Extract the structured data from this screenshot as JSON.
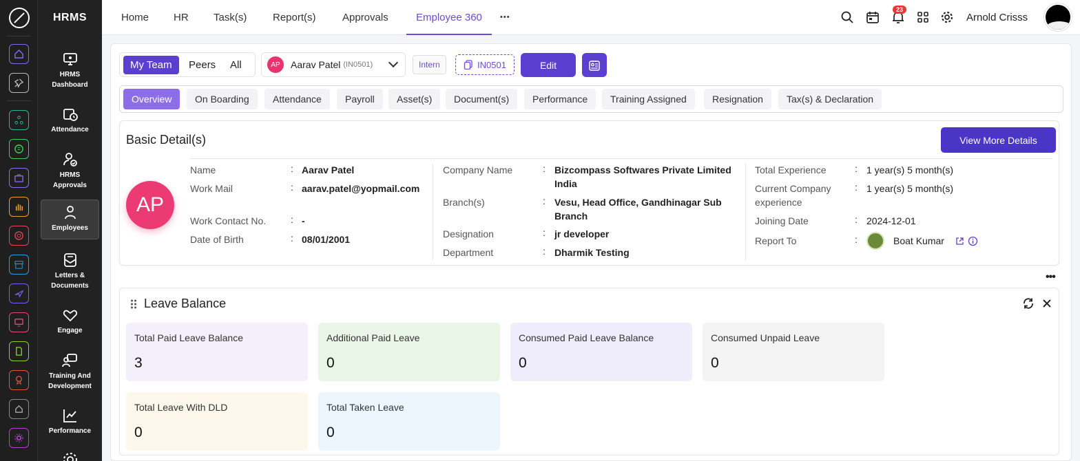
{
  "app": {
    "name": "HRMS"
  },
  "sidebar": {
    "items": [
      {
        "label_line1": "HRMS",
        "label_line2": "Dashboard"
      },
      {
        "label_line1": "Attendance",
        "label_line2": ""
      },
      {
        "label_line1": "HRMS",
        "label_line2": "Approvals"
      },
      {
        "label_line1": "Employees",
        "label_line2": ""
      },
      {
        "label_line1": "Letters &",
        "label_line2": "Documents"
      },
      {
        "label_line1": "Engage",
        "label_line2": ""
      },
      {
        "label_line1": "Training And",
        "label_line2": "Development"
      },
      {
        "label_line1": "Performance",
        "label_line2": ""
      }
    ]
  },
  "topnav": {
    "items": [
      "Home",
      "HR",
      "Task(s)",
      "Report(s)",
      "Approvals",
      "Employee 360"
    ],
    "more": "•••",
    "notifications_count": "23",
    "user_name": "Arnold Crisss"
  },
  "filter": {
    "segments": [
      "My Team",
      "Peers",
      "All"
    ],
    "employee_initials": "AP",
    "employee_name": "Aarav Patel",
    "employee_code": "(IN0501)",
    "type_tag": "Intern",
    "code_tag": "IN0501",
    "edit_label": "Edit"
  },
  "tabs": [
    "Overview",
    "On Boarding",
    "Attendance",
    "Payroll",
    "Asset(s)",
    "Document(s)",
    "Performance",
    "Training Assigned",
    "Resignation",
    "Tax(s) & Declaration"
  ],
  "basic": {
    "title": "Basic Detail(s)",
    "view_more": "View More Details",
    "avatar_initials": "AP",
    "col1": [
      {
        "label": "Name",
        "value": "Aarav Patel"
      },
      {
        "label": "Work Mail",
        "value": "aarav.patel@yopmail.com"
      },
      {
        "label": "Work Contact No.",
        "value": "-"
      },
      {
        "label": "Date of Birth",
        "value": "08/01/2001"
      }
    ],
    "col2": [
      {
        "label": "Company Name",
        "value": "Bizcompass Softwares Private Limited India"
      },
      {
        "label": "Branch(s)",
        "value": "Vesu, Head Office, Gandhinagar Sub Branch"
      },
      {
        "label": "Designation",
        "value": "jr developer"
      },
      {
        "label": "Department",
        "value": "Dharmik Testing"
      }
    ],
    "col3": [
      {
        "label": "Total Experience",
        "value": "1 year(s) 5 month(s)"
      },
      {
        "label": "Current Company experience",
        "value": "1 year(s) 5 month(s)"
      },
      {
        "label": "Joining Date",
        "value": "2024-12-01"
      },
      {
        "label": "Report To",
        "value": "Boat Kumar"
      }
    ],
    "colon": ":"
  },
  "leave": {
    "title": "Leave Balance",
    "cards": [
      {
        "label": "Total Paid Leave Balance",
        "value": "3",
        "color": "#f5effb"
      },
      {
        "label": "Additional Paid Leave",
        "value": "0",
        "color": "#e9f5e6"
      },
      {
        "label": "Consumed Paid Leave Balance",
        "value": "0",
        "color": "#efedfb"
      },
      {
        "label": "Consumed Unpaid Leave",
        "value": "0",
        "color": "#f3f3f3"
      },
      {
        "label": "Total Leave With DLD",
        "value": "0",
        "color": "#fdf7ec"
      },
      {
        "label": "Total Taken Leave",
        "value": "0",
        "color": "#edf6fc"
      }
    ]
  },
  "colors": {
    "primary": "#5b3fd1",
    "accent_tab": "#8b6ee8",
    "avatar_pink": "#ec3a74",
    "badge_red": "#e53935"
  }
}
